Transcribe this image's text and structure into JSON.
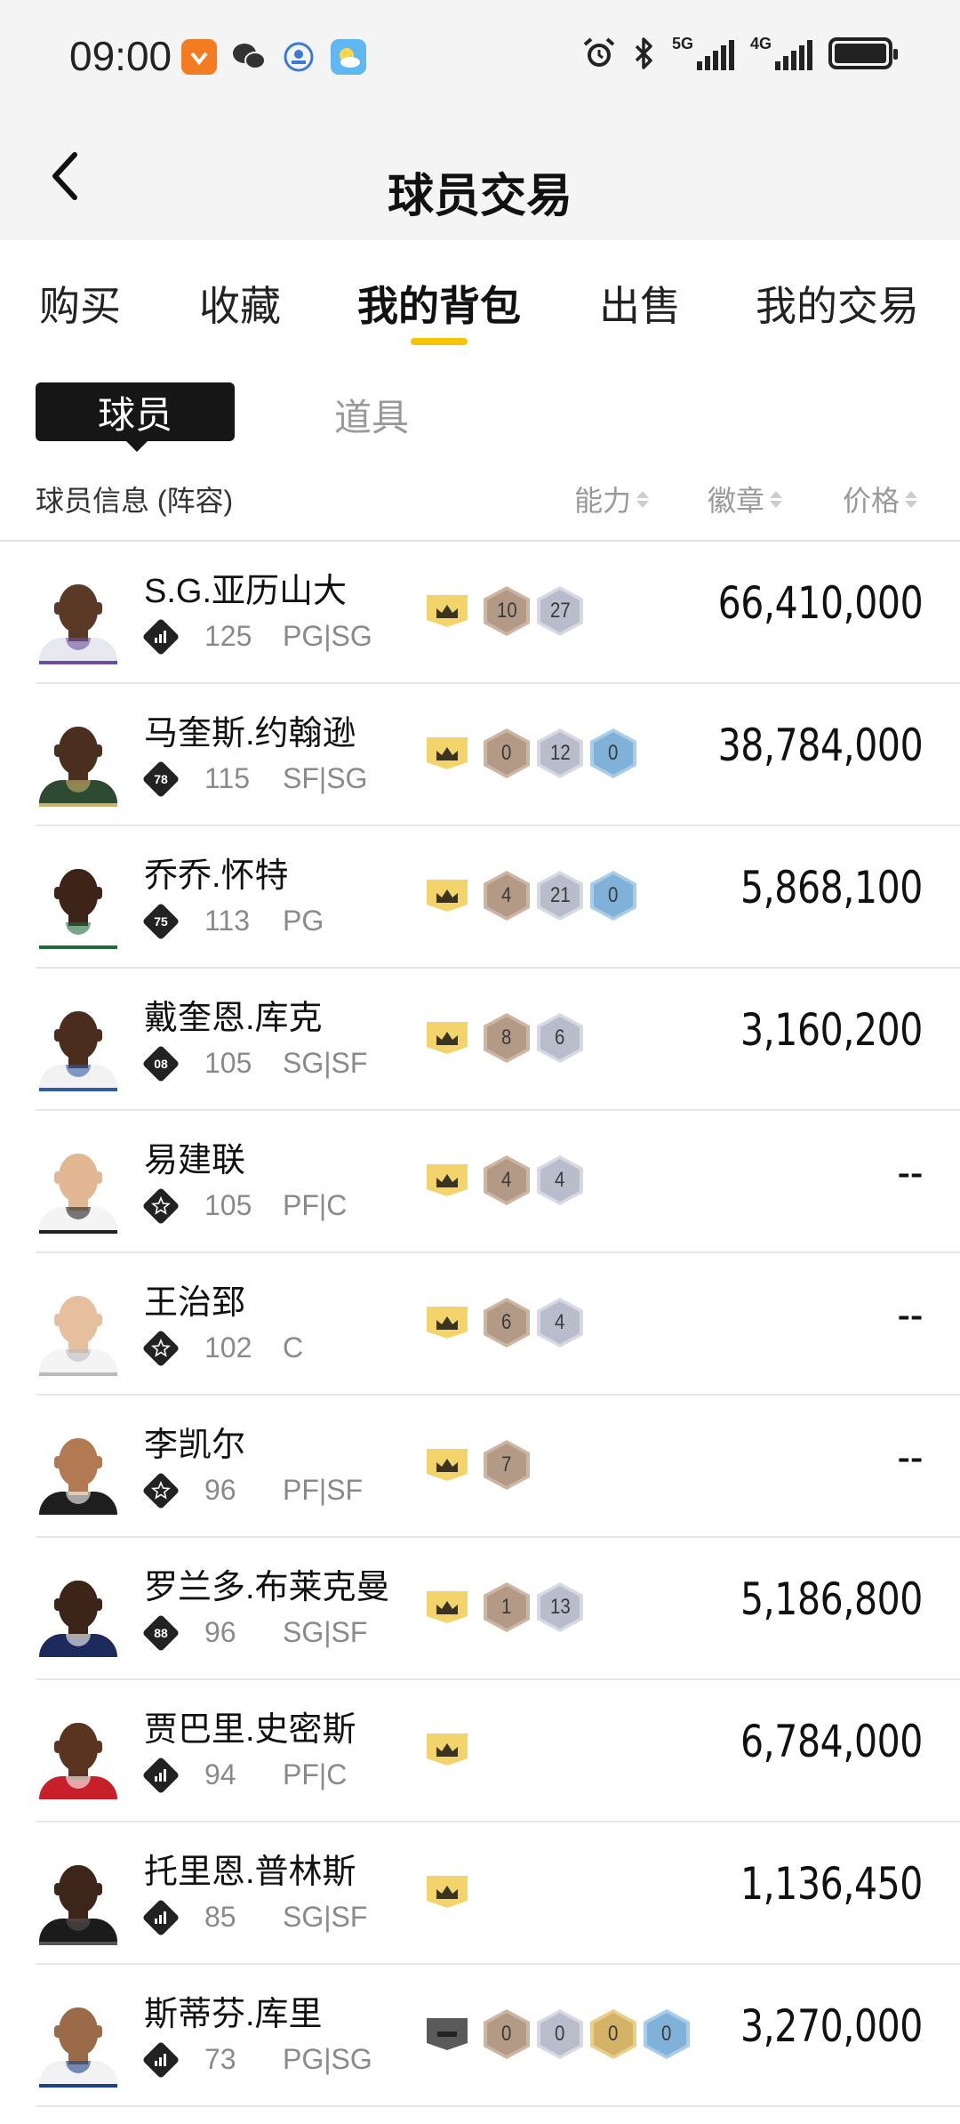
{
  "status_bar": {
    "time": "09:00",
    "apps": [
      {
        "icon": "app-orange-icon",
        "color": "#f47b20"
      },
      {
        "icon": "wechat-icon",
        "color": "#333333"
      },
      {
        "icon": "app-circle-icon",
        "color": "#3a7bd5"
      },
      {
        "icon": "weather-icon",
        "color": "#5fb8f2"
      }
    ],
    "net1": "5G",
    "net2": "4G"
  },
  "header": {
    "title": "球员交易"
  },
  "tabs": [
    {
      "label": "购买"
    },
    {
      "label": "收藏"
    },
    {
      "label": "我的背包",
      "active": true
    },
    {
      "label": "出售"
    },
    {
      "label": "我的交易"
    }
  ],
  "subtabs": {
    "active": "球员",
    "inactive": "道具"
  },
  "columns": {
    "info": "球员信息 (阵容)",
    "ability": "能力",
    "badge": "徽章",
    "price": "价格"
  },
  "players": [
    {
      "name": "S.G.亚历山大",
      "rank": "",
      "ovr": "125",
      "pos": "PG|SG",
      "crown": "gold",
      "badges": [
        {
          "v": "10",
          "t": "bronze"
        },
        {
          "v": "27",
          "t": "silver"
        }
      ],
      "price": "66,410,000",
      "skin": "#5a3a26",
      "jersey": "#e8e8f0",
      "trim": "#6b4fa0"
    },
    {
      "name": "马奎斯.约翰逊",
      "rank": "78",
      "ovr": "115",
      "pos": "SF|SG",
      "crown": "gold",
      "badges": [
        {
          "v": "0",
          "t": "bronze"
        },
        {
          "v": "12",
          "t": "silver"
        },
        {
          "v": "0",
          "t": "blue"
        }
      ],
      "price": "38,784,000",
      "skin": "#4a2f1e",
      "jersey": "#2f4a33",
      "trim": "#c9b36b"
    },
    {
      "name": "乔乔.怀特",
      "rank": "75",
      "ovr": "113",
      "pos": "PG",
      "crown": "gold",
      "badges": [
        {
          "v": "4",
          "t": "bronze"
        },
        {
          "v": "21",
          "t": "silver"
        },
        {
          "v": "0",
          "t": "blue"
        }
      ],
      "price": "5,868,100",
      "skin": "#3e2418",
      "jersey": "#ffffff",
      "trim": "#1f6b3a"
    },
    {
      "name": "戴奎恩.库克",
      "rank": "08",
      "ovr": "105",
      "pos": "SG|SF",
      "crown": "gold",
      "badges": [
        {
          "v": "8",
          "t": "bronze"
        },
        {
          "v": "6",
          "t": "silver"
        }
      ],
      "price": "3,160,200",
      "skin": "#4b2d1d",
      "jersey": "#f2f2f2",
      "trim": "#2f5aa8"
    },
    {
      "name": "易建联",
      "rank": "",
      "ovr": "105",
      "pos": "PF|C",
      "crown": "gold",
      "badges": [
        {
          "v": "4",
          "t": "bronze"
        },
        {
          "v": "4",
          "t": "silver"
        }
      ],
      "price": "--",
      "skin": "#e2b894",
      "jersey": "#f4f4f4",
      "trim": "#222222"
    },
    {
      "name": "王治郅",
      "rank": "",
      "ovr": "102",
      "pos": "C",
      "crown": "gold",
      "badges": [
        {
          "v": "6",
          "t": "bronze"
        },
        {
          "v": "4",
          "t": "silver"
        }
      ],
      "price": "--",
      "skin": "#e6bf9e",
      "jersey": "#f4f4f4",
      "trim": "#bbbbbb"
    },
    {
      "name": "李凯尔",
      "rank": "",
      "ovr": "96",
      "pos": "PF|SF",
      "crown": "gold",
      "badges": [
        {
          "v": "7",
          "t": "bronze"
        }
      ],
      "price": "--",
      "skin": "#b27a52",
      "jersey": "#1e1e1e",
      "trim": "#ffffff"
    },
    {
      "name": "罗兰多.布莱克曼",
      "rank": "88",
      "ovr": "96",
      "pos": "SG|SF",
      "crown": "gold",
      "badges": [
        {
          "v": "1",
          "t": "bronze"
        },
        {
          "v": "13",
          "t": "silver"
        }
      ],
      "price": "5,186,800",
      "skin": "#3c2418",
      "jersey": "#1d2b5c",
      "trim": "#ffffff"
    },
    {
      "name": "贾巴里.史密斯",
      "rank": "",
      "ovr": "94",
      "pos": "PF|C",
      "crown": "gold",
      "badges": [],
      "price": "6,784,000",
      "skin": "#5a3420",
      "jersey": "#c8202a",
      "trim": "#ffffff"
    },
    {
      "name": "托里恩.普林斯",
      "rank": "",
      "ovr": "85",
      "pos": "SG|SF",
      "crown": "gold",
      "badges": [],
      "price": "1,136,450",
      "skin": "#3d2519",
      "jersey": "#1b1b1b",
      "trim": "#555555"
    },
    {
      "name": "斯蒂芬.库里",
      "rank": "",
      "ovr": "73",
      "pos": "PG|SG",
      "crown": "gray",
      "badges": [
        {
          "v": "0",
          "t": "bronze"
        },
        {
          "v": "0",
          "t": "silver"
        },
        {
          "v": "0",
          "t": "gold"
        },
        {
          "v": "0",
          "t": "blue"
        }
      ],
      "price": "3,270,000",
      "skin": "#9b6a48",
      "jersey": "#f2f2f2",
      "trim": "#1d428a"
    }
  ],
  "colors": {
    "accent": "#f7c400",
    "crown_gold": "#f2d46b",
    "crown_gray": "#5a5a5a"
  }
}
